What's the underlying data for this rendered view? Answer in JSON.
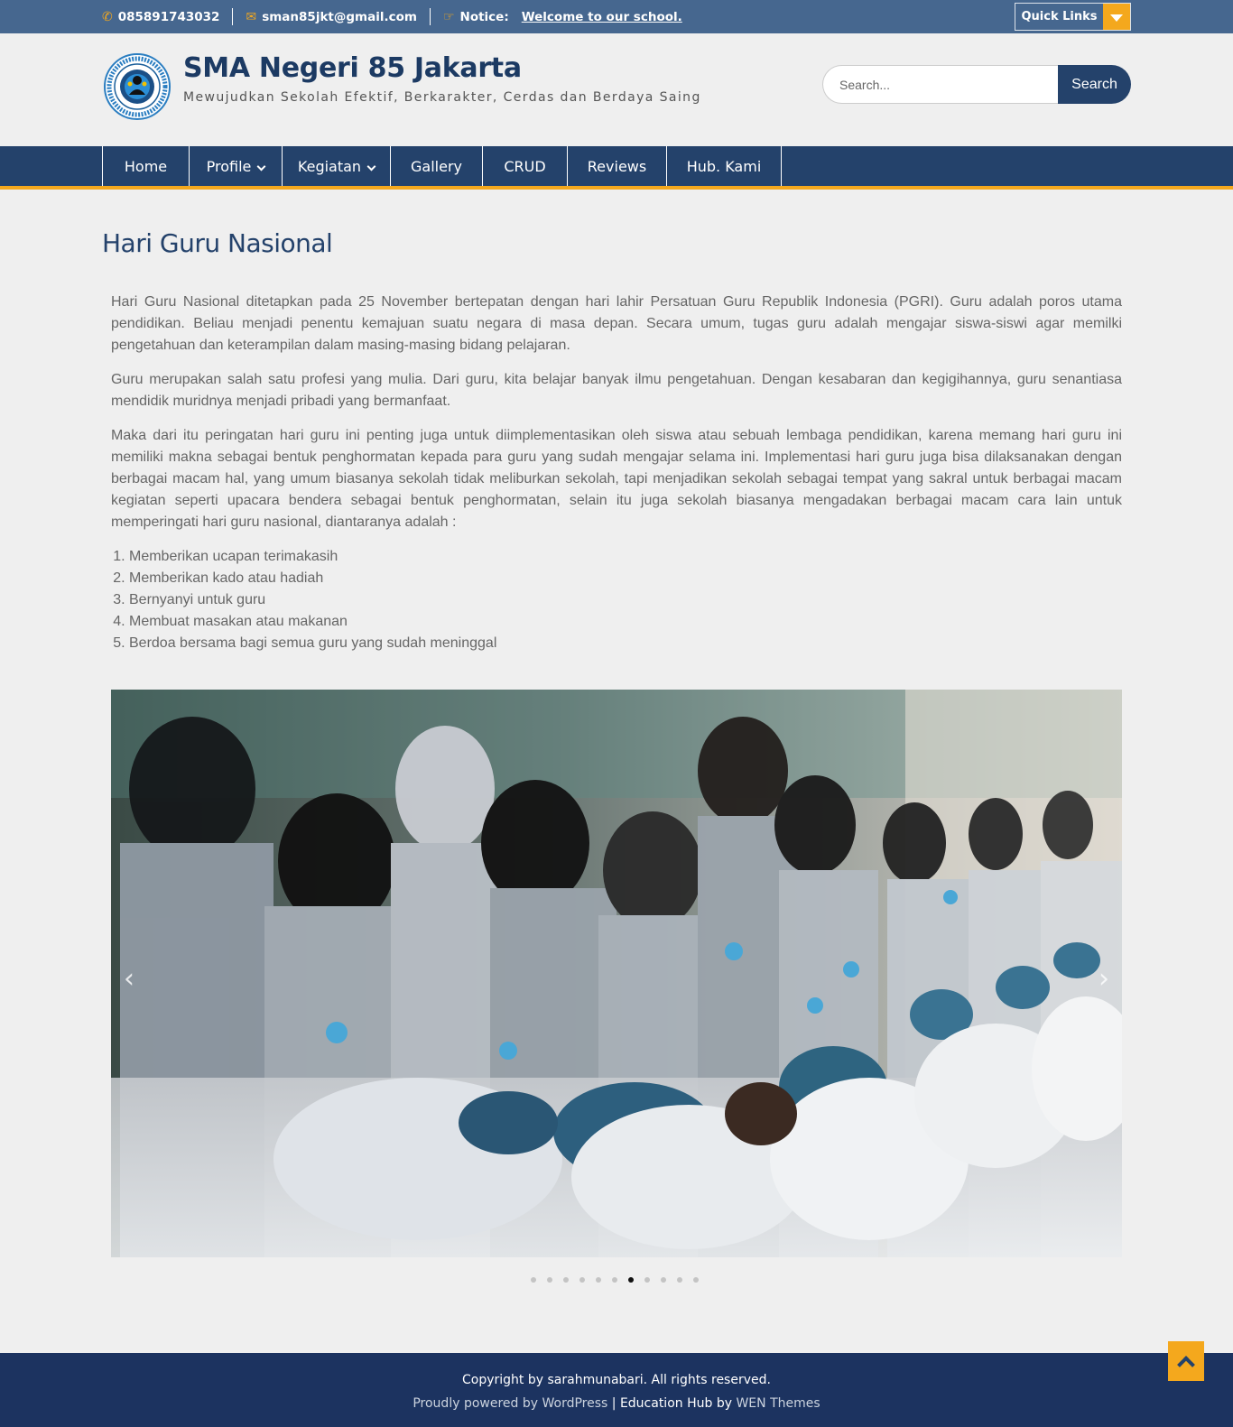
{
  "topbar": {
    "phone": "085891743032",
    "email": "sman85jkt@gmail.com",
    "notice_label": "Notice:",
    "notice_text": "Welcome to our school.",
    "quick_links": "Quick Links"
  },
  "header": {
    "site_title": "SMA Negeri 85 Jakarta",
    "site_description": "Mewujudkan Sekolah Efektif, Berkarakter, Cerdas dan Berdaya Saing",
    "search_placeholder": "Search...",
    "search_button": "Search"
  },
  "nav": {
    "items": [
      {
        "label": "Home",
        "dropdown": false
      },
      {
        "label": "Profile",
        "dropdown": true
      },
      {
        "label": "Kegiatan",
        "dropdown": true
      },
      {
        "label": "Gallery",
        "dropdown": false
      },
      {
        "label": "CRUD",
        "dropdown": false
      },
      {
        "label": "Reviews",
        "dropdown": false
      },
      {
        "label": "Hub. Kami",
        "dropdown": false
      }
    ]
  },
  "article": {
    "title": "Hari Guru Nasional",
    "paragraphs": [
      "Hari Guru Nasional ditetapkan pada 25 November bertepatan dengan hari lahir Persatuan Guru Republik Indonesia (PGRI). Guru adalah poros utama pendidikan. Beliau menjadi penentu kemajuan suatu negara di masa depan. Secara umum, tugas guru adalah mengajar siswa-siswi agar memilki pengetahuan dan keterampilan dalam masing-masing bidang pelajaran.",
      "Guru merupakan salah satu profesi yang mulia. Dari guru, kita belajar banyak ilmu pengetahuan. Dengan kesabaran dan kegigihannya, guru senantiasa mendidik muridnya menjadi pribadi yang bermanfaat.",
      "Maka dari itu peringatan hari guru ini penting juga untuk diimplementasikan oleh siswa atau sebuah lembaga pendidikan, karena memang hari guru ini memiliki makna sebagai bentuk penghormatan kepada para guru yang sudah mengajar selama ini. Implementasi hari guru juga bisa dilaksanakan dengan berbagai macam hal, yang umum biasanya sekolah tidak meliburkan sekolah, tapi menjadikan sekolah sebagai tempat yang sakral untuk berbagai macam kegiatan seperti upacara bendera sebagai bentuk penghormatan, selain itu juga sekolah biasanya mengadakan berbagai macam cara lain untuk memperingati hari guru nasional, diantaranya adalah :"
    ],
    "list": [
      "Memberikan ucapan terimakasih",
      "Memberikan kado atau hadiah",
      "Bernyanyi untuk guru",
      "Membuat masakan atau makanan",
      "Berdoa bersama bagi semua guru yang sudah meninggal"
    ]
  },
  "slider": {
    "prev_icon": "‹",
    "next_icon": "›",
    "dot_count": 11,
    "active_dot": 7
  },
  "footer": {
    "copyright": "Copyright by sarahmunabari. All rights reserved.",
    "powered_prefix": "Proudly powered by WordPress",
    "separator": "|",
    "theme_name": "Education Hub",
    "by": "by",
    "theme_author": "WEN Themes"
  },
  "colors": {
    "topbar": "#46678f",
    "nav": "#24426b",
    "accent": "#f4a81d",
    "footer": "#1c3360"
  }
}
